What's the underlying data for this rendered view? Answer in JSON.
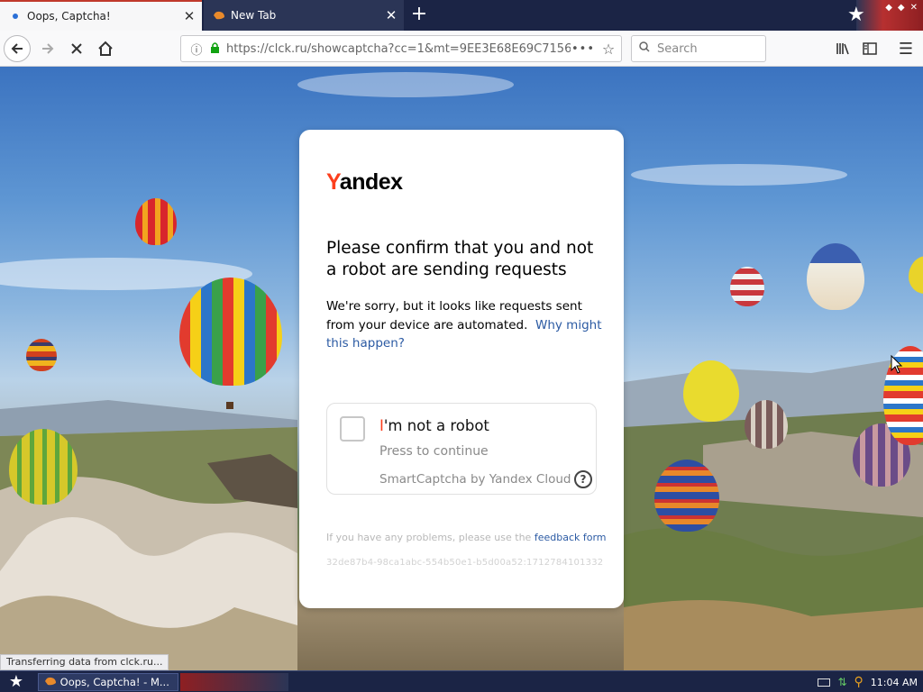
{
  "browser": {
    "tabs": [
      {
        "title": "Oops, Captcha!",
        "active": true
      },
      {
        "title": "New Tab",
        "active": false
      }
    ],
    "new_tab_label": "+",
    "url": "https://clck.ru/showcaptcha?cc=1&mt=9EE3E68E69C71567",
    "search_placeholder": "Search",
    "status_text": "Transferring data from clck.ru..."
  },
  "captcha": {
    "logo_y": "Y",
    "logo_rest": "andex",
    "heading": "Please confirm that you and not a robot are sending requests",
    "message": "We're sorry, but it looks like requests sent from your device are automated.",
    "why_link": "Why might this happen?",
    "checkbox_label_i": "I",
    "checkbox_label_rest": "'m not a robot",
    "checkbox_sub": "Press to continue",
    "brand": "SmartCaptcha by Yandex Cloud",
    "help_icon": "?",
    "problems_text": "If you have any problems, please use the",
    "feedback_link": "feedback form",
    "request_id": "32de87b4-98ca1abc-554b50e1-b5d00a52:1712784101332"
  },
  "taskbar": {
    "task_title": "Oops, Captcha! - M...",
    "clock": "11:04 AM"
  },
  "colors": {
    "yandex_red": "#fc3f1d",
    "link_blue": "#2b5aa3",
    "tab_strip": "#1b2445"
  }
}
